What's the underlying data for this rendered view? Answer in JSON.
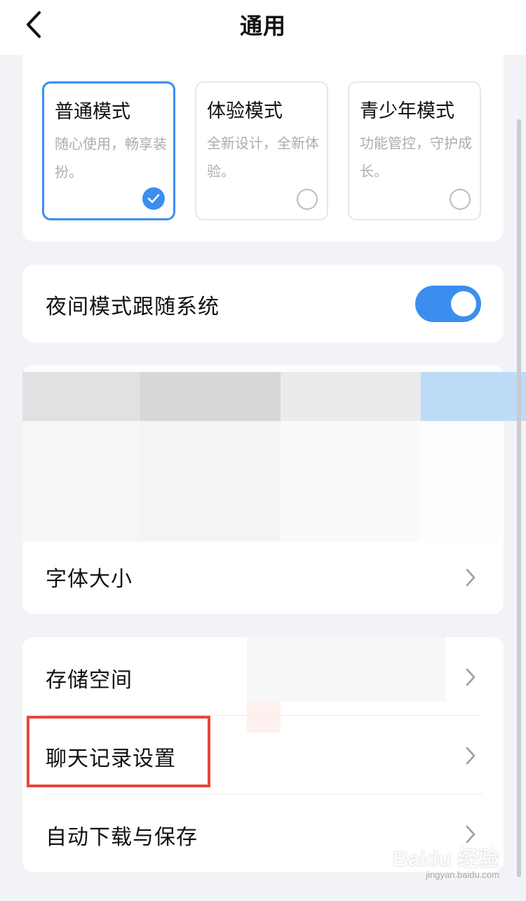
{
  "header": {
    "title": "通用"
  },
  "modes": [
    {
      "title": "普通模式",
      "desc": "随心使用，畅享装扮。",
      "selected": true
    },
    {
      "title": "体验模式",
      "desc": "全新设计，全新体验。",
      "selected": false
    },
    {
      "title": "青少年模式",
      "desc": "功能管控，守护成长。",
      "selected": false
    }
  ],
  "night_mode": {
    "label": "夜间模式跟随系统",
    "enabled": true
  },
  "font_size": {
    "label": "字体大小"
  },
  "storage_rows": [
    {
      "label": "存储空间"
    },
    {
      "label": "聊天记录设置"
    },
    {
      "label": "自动下载与保存"
    }
  ],
  "watermark": {
    "logo": "Baidu 经验",
    "url": "jingyan.baidu.com"
  },
  "colors": {
    "accent": "#3b8ef0",
    "highlight": "#e8463c",
    "background": "#f2f3f7"
  }
}
